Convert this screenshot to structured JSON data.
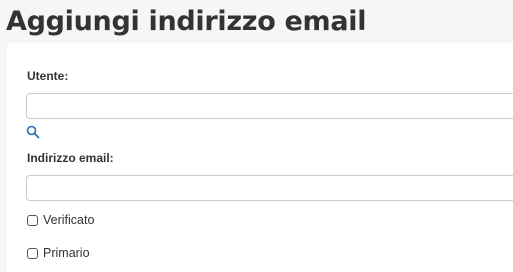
{
  "page": {
    "title": "Aggiungi indirizzo email"
  },
  "form": {
    "user": {
      "label": "Utente:",
      "value": "",
      "search_icon": "search-icon"
    },
    "email": {
      "label": "Indirizzo email:",
      "value": ""
    },
    "verified": {
      "label": "Verificato",
      "checked": false
    },
    "primary": {
      "label": "Primario",
      "checked": false
    }
  },
  "colors": {
    "background": "#f6f6f7",
    "card": "#ffffff",
    "text": "#333333",
    "input_border": "#c9ccd1",
    "accent": "#2a6fb4"
  }
}
